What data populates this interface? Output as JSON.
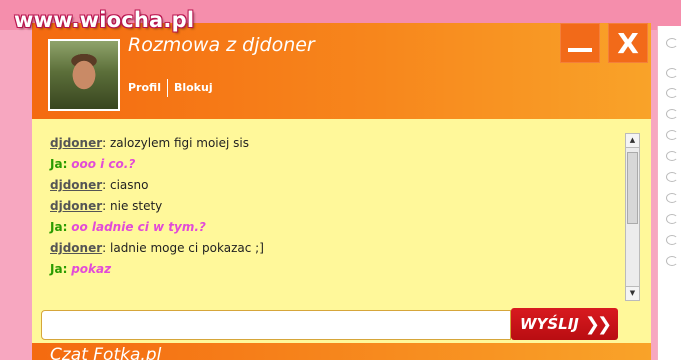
{
  "watermark": "www.wiocha.pl",
  "window": {
    "title": "Rozmowa z djdoner",
    "links": {
      "profile": "Profil",
      "block": "Blokuj"
    },
    "minimize": "_",
    "close": "X"
  },
  "messages": [
    {
      "nick": "djdoner",
      "text": "zalozylem figi moiej sis"
    },
    {
      "nick": "Ja",
      "text": "ooo i co.?"
    },
    {
      "nick": "djdoner",
      "text": "ciasno"
    },
    {
      "nick": "djdoner",
      "text": "nie stety"
    },
    {
      "nick": "Ja",
      "text": "oo ladnie ci w tym.?"
    },
    {
      "nick": "djdoner",
      "text": "ladnie moge ci pokazac ;]"
    },
    {
      "nick": "Ja",
      "text": "pokaz"
    }
  ],
  "input": {
    "value": "",
    "placeholder": ""
  },
  "send_label": "WYŚLIJ",
  "send_icon": "double-chevron-right-icon",
  "bottom_title": "Czat Fotka.pl",
  "colors": {
    "orange": "#f46a10",
    "pink": "#f7a7c0",
    "chat_bg": "#fff89a",
    "send_red": "#c8141a"
  }
}
